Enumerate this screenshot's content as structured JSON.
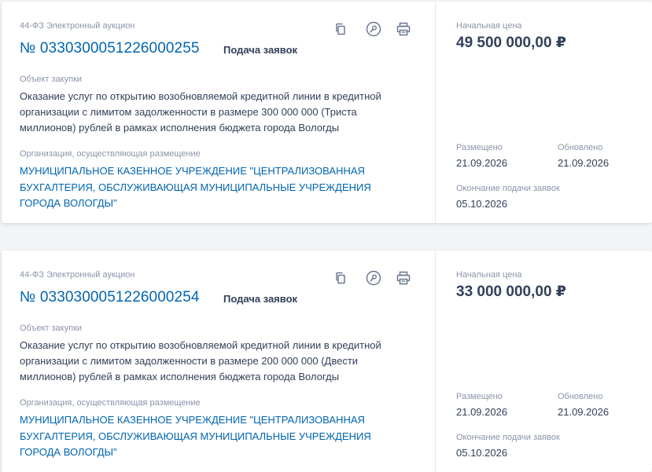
{
  "cards": [
    {
      "law_type": "44-ФЗ Электронный аукцион",
      "number": "№ 0330300051226000255",
      "status": "Подача заявок",
      "object_label": "Объект закупки",
      "object_text": "Оказание услуг по открытию возобновляемой кредитной линии в кредитной организации с лимитом задолженности в размере 300 000 000 (Триста миллионов) рублей в рамках исполнения бюджета города Вологды",
      "org_label": "Организация, осуществляющая размещение",
      "org_name": "МУНИЦИПАЛЬНОЕ КАЗЕННОЕ УЧРЕЖДЕНИЕ \"ЦЕНТРАЛИЗОВАННАЯ БУХГАЛТЕРИЯ, ОБСЛУЖИВАЮЩАЯ МУНИЦИПАЛЬНЫЕ УЧРЕЖДЕНИЯ ГОРОДА ВОЛОГДЫ\"",
      "price_label": "Начальная цена",
      "price": "49 500 000,00 ₽",
      "posted_label": "Размещено",
      "posted_date": "21.09.2026",
      "updated_label": "Обновлено",
      "updated_date": "21.09.2026",
      "deadline_label": "Окончание подачи заявок",
      "deadline_date": "05.10.2026"
    },
    {
      "law_type": "44-ФЗ Электронный аукцион",
      "number": "№ 0330300051226000254",
      "status": "Подача заявок",
      "object_label": "Объект закупки",
      "object_text": "Оказание услуг по открытию возобновляемой кредитной линии в кредитной организации с лимитом задолженности в размере 200 000 000 (Двести миллионов) рублей в рамках исполнения бюджета города Вологды",
      "org_label": "Организация, осуществляющая размещение",
      "org_name": "МУНИЦИПАЛЬНОЕ КАЗЕННОЕ УЧРЕЖДЕНИЕ \"ЦЕНТРАЛИЗОВАННАЯ БУХГАЛТЕРИЯ, ОБСЛУЖИВАЮЩАЯ МУНИЦИПАЛЬНЫЕ УЧРЕЖДЕНИЯ ГОРОДА ВОЛОГДЫ\"",
      "price_label": "Начальная цена",
      "price": "33 000 000,00 ₽",
      "posted_label": "Размещено",
      "posted_date": "21.09.2026",
      "updated_label": "Обновлено",
      "updated_date": "21.09.2026",
      "deadline_label": "Окончание подачи заявок",
      "deadline_date": "05.10.2026"
    }
  ],
  "icons": [
    "copy-icon",
    "eye-icon",
    "printer-icon"
  ],
  "colors": {
    "link": "#0065b1",
    "text": "#334059",
    "muted": "#8a94a8",
    "icon": "#6b7894"
  }
}
